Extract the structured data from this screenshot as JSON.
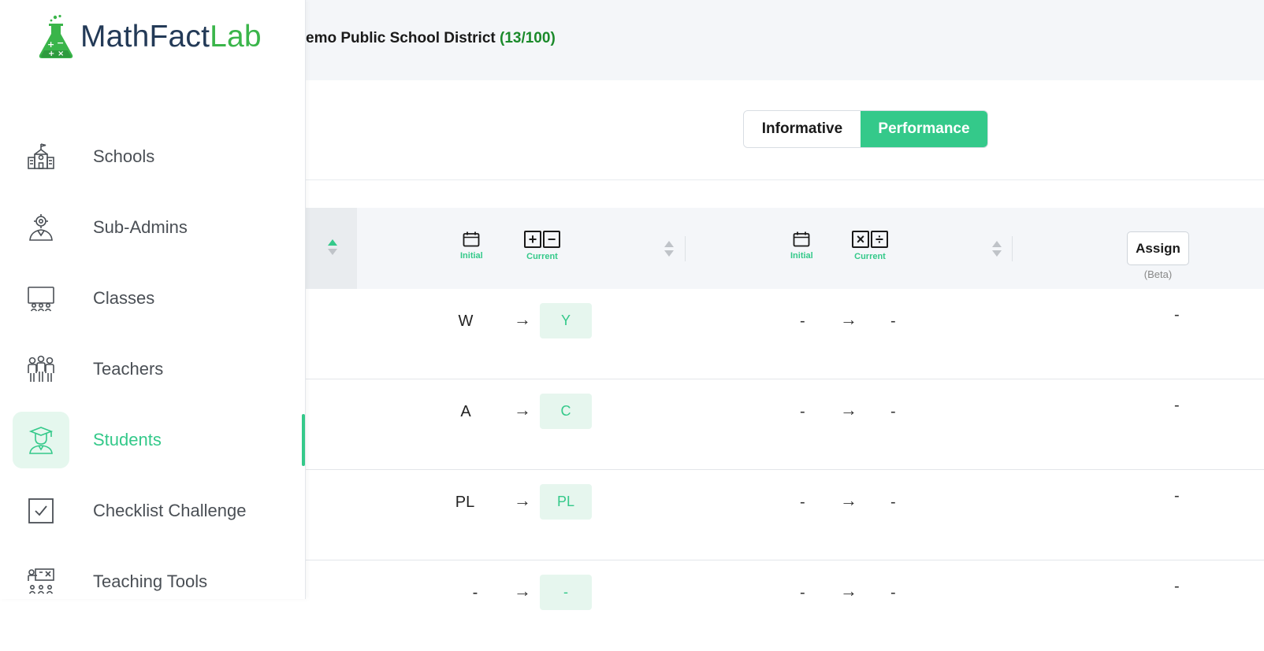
{
  "app": {
    "logo_prefix": "MathFact",
    "logo_suffix": "Lab"
  },
  "header": {
    "district_name": "emo Public School District",
    "district_count": "(13/100)"
  },
  "view_toggle": {
    "informative_label": "Informative",
    "performance_label": "Performance",
    "selected": "Performance"
  },
  "sidebar": {
    "items": [
      {
        "label": "Schools",
        "icon": "school-icon"
      },
      {
        "label": "Sub-Admins",
        "icon": "sub-admin-icon"
      },
      {
        "label": "Classes",
        "icon": "classroom-icon"
      },
      {
        "label": "Teachers",
        "icon": "teachers-icon"
      },
      {
        "label": "Students",
        "icon": "student-icon",
        "active": true
      },
      {
        "label": "Checklist Challenge",
        "icon": "checklist-icon"
      },
      {
        "label": "Teaching Tools",
        "icon": "teaching-tools-icon"
      }
    ]
  },
  "table": {
    "add_sub": {
      "initial_label": "Initial",
      "current_label": "Current",
      "icon": "add-subtract-icon"
    },
    "mult_div": {
      "initial_label": "Initial",
      "current_label": "Current",
      "icon": "multiply-divide-icon"
    },
    "assign_label": "Assign",
    "beta_label": "(Beta)",
    "rows": [
      {
        "as_initial": "W",
        "as_current": "Y",
        "md_initial": "-",
        "md_current": "-",
        "assign": "-"
      },
      {
        "as_initial": "A",
        "as_current": "C",
        "md_initial": "-",
        "md_current": "-",
        "assign": "-"
      },
      {
        "as_initial": "PL",
        "as_current": "PL",
        "md_initial": "-",
        "md_current": "-",
        "assign": "-"
      },
      {
        "as_initial": "-",
        "as_current": "-",
        "md_initial": "-",
        "md_current": "-",
        "assign": "-"
      }
    ],
    "arrow_glyph": "→"
  },
  "colors": {
    "accent": "#34c98a",
    "logo_dark": "#233a57",
    "logo_green": "#3ab54a",
    "count_green": "#1b8a2b"
  }
}
